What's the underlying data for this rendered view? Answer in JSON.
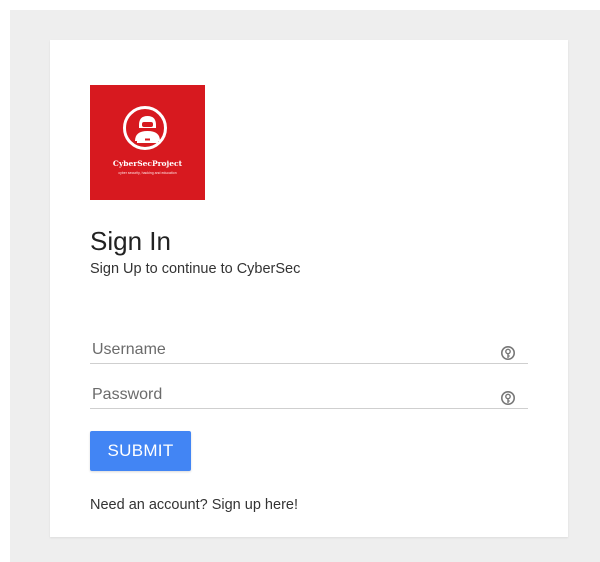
{
  "logo": {
    "title": "CyberSecProject",
    "subtitle": "cyber security, hacking and education",
    "icon": "hacker-icon",
    "background_color": "#d7191f"
  },
  "header": {
    "title": "Sign In",
    "subtitle": "Sign Up to continue to CyberSec"
  },
  "form": {
    "username": {
      "placeholder": "Username",
      "value": "",
      "icon": "key-icon"
    },
    "password": {
      "placeholder": "Password",
      "value": "",
      "icon": "key-icon"
    },
    "submit_label": "SUBMIT",
    "submit_color": "#4285f4"
  },
  "footer": {
    "signup_text": "Need an account? Sign up here!"
  }
}
